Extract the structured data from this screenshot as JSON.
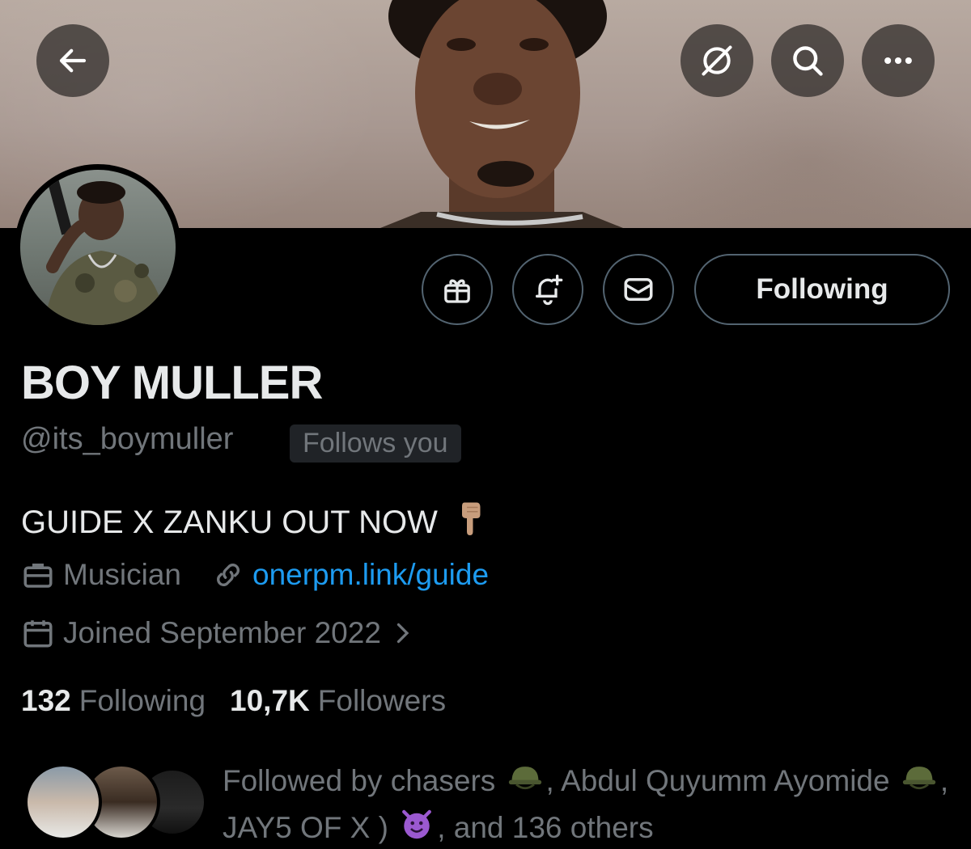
{
  "header": {
    "back_icon": "arrow-left-icon",
    "grok_icon": "grok-icon",
    "search_icon": "search-icon",
    "more_icon": "more-horizontal-icon"
  },
  "profile": {
    "display_name": "BOY MULLER",
    "handle": "@its_boymuller",
    "follows_you_badge": "Follows you",
    "bio": "GUIDE X ZANKU OUT NOW",
    "bio_emoji": "pointing-down-emoji",
    "category": "Musician",
    "website": "onerpm.link/guide",
    "joined": "Joined September 2022",
    "following_count": "132",
    "following_label": "Following",
    "followers_count": "10,7K",
    "followers_label": "Followers"
  },
  "actions": {
    "gift_icon": "gift-icon",
    "notify_icon": "bell-plus-icon",
    "message_icon": "envelope-icon",
    "following_button_label": "Following"
  },
  "followed_by": {
    "prefix": "Followed by chasers",
    "name2": ", Abdul Quyumm Ayomide",
    "name3": ", JAY5 OF X )",
    "suffix": ", and 136 others"
  },
  "colors": {
    "background": "#000000",
    "text_primary": "#e7e9ea",
    "text_secondary": "#71767b",
    "link": "#1d9bf0",
    "border": "#536471"
  }
}
